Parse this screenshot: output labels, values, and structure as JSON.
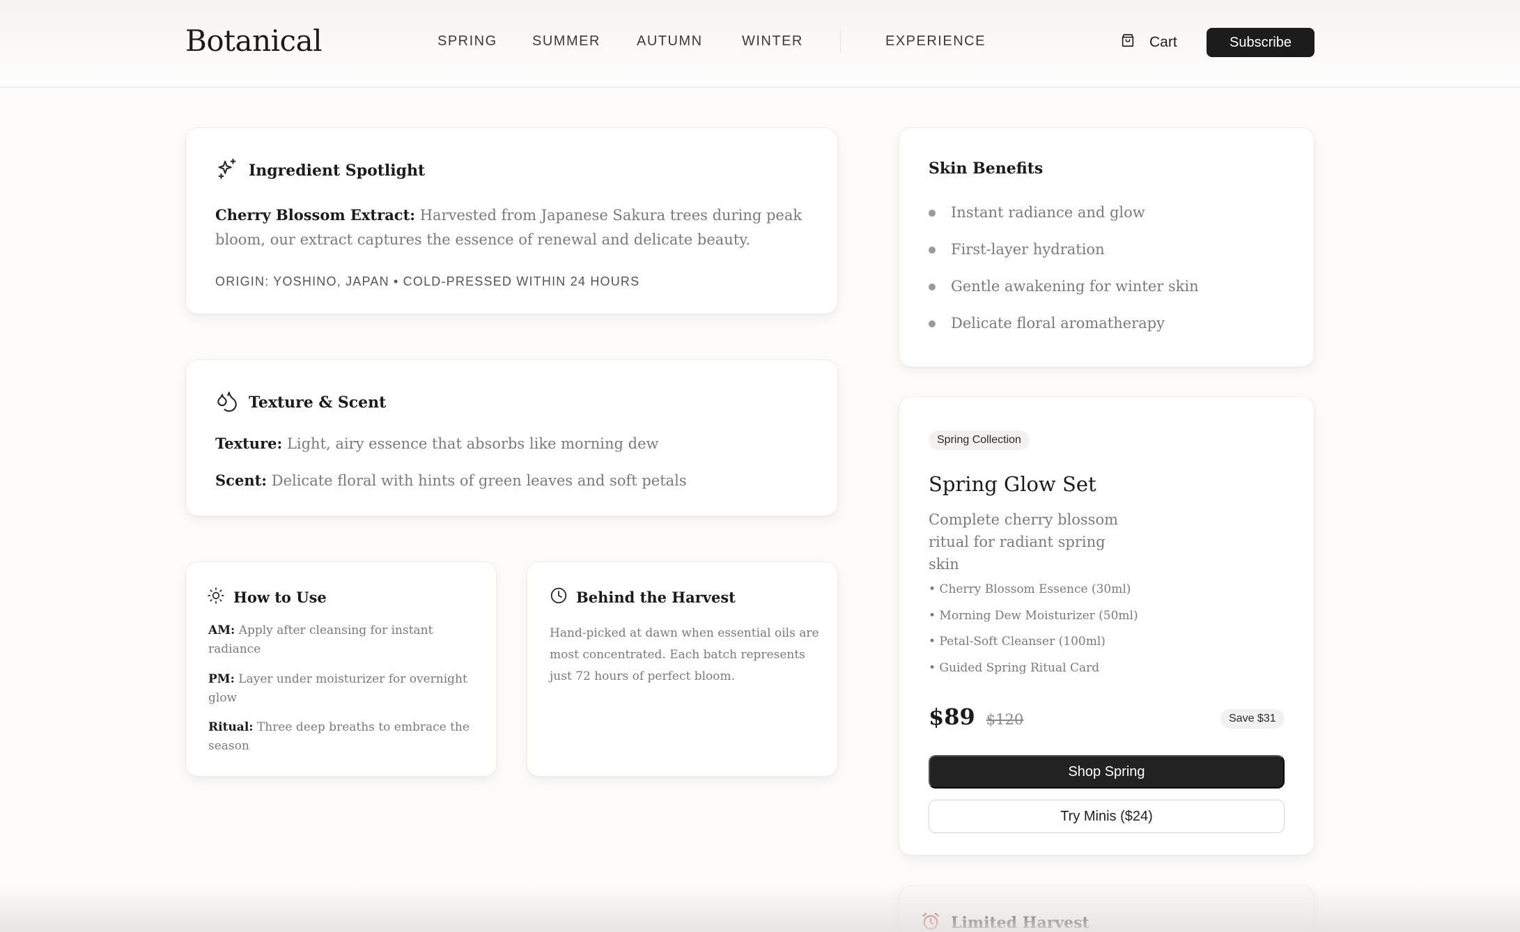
{
  "header": {
    "brand": "Botanical",
    "nav": [
      "SPRING",
      "SUMMER",
      "AUTUMN",
      "WINTER",
      "EXPERIENCE"
    ],
    "cart_label": "Cart",
    "subscribe_label": "Subscribe"
  },
  "ingredient": {
    "title": "Ingredient Spotlight",
    "name": "Cherry Blossom Extract:",
    "description": "Harvested from Japanese Sakura trees during peak bloom, our extract captures the essence of renewal and delicate beauty.",
    "origin": "ORIGIN: YOSHINO, JAPAN • COLD-PRESSED WITHIN 24 HOURS"
  },
  "texture": {
    "title": "Texture & Scent",
    "texture_label": "Texture:",
    "texture_value": "Light, airy essence that absorbs like morning dew",
    "scent_label": "Scent:",
    "scent_value": "Delicate floral with hints of green leaves and soft petals"
  },
  "how_to_use": {
    "title": "How to Use",
    "steps": [
      {
        "label": "AM:",
        "text": "Apply after cleansing for instant radiance"
      },
      {
        "label": "PM:",
        "text": "Layer under moisturizer for overnight glow"
      },
      {
        "label": "Ritual:",
        "text": "Three deep breaths to embrace the season"
      }
    ]
  },
  "harvest": {
    "title": "Behind the Harvest",
    "text": "Hand-picked at dawn when essential oils are most concentrated. Each batch represents just 72 hours of perfect bloom."
  },
  "benefits": {
    "title": "Skin Benefits",
    "items": [
      "Instant radiance and glow",
      "First-layer hydration",
      "Gentle awakening for winter skin",
      "Delicate floral aromatherapy"
    ]
  },
  "product": {
    "badge": "Spring Collection",
    "title": "Spring Glow Set",
    "subtitle": "Complete cherry blossom ritual for radiant spring skin",
    "items": [
      "• Cherry Blossom Essence (30ml)",
      "• Morning Dew Moisturizer (50ml)",
      "• Petal-Soft Cleanser (100ml)",
      "• Guided Spring Ritual Card"
    ],
    "price": "$89",
    "original_price": "$120",
    "save": "Save $31",
    "primary_cta": "Shop Spring",
    "secondary_cta": "Try Minis ($24)"
  },
  "limited": {
    "title": "Limited Harvest"
  }
}
